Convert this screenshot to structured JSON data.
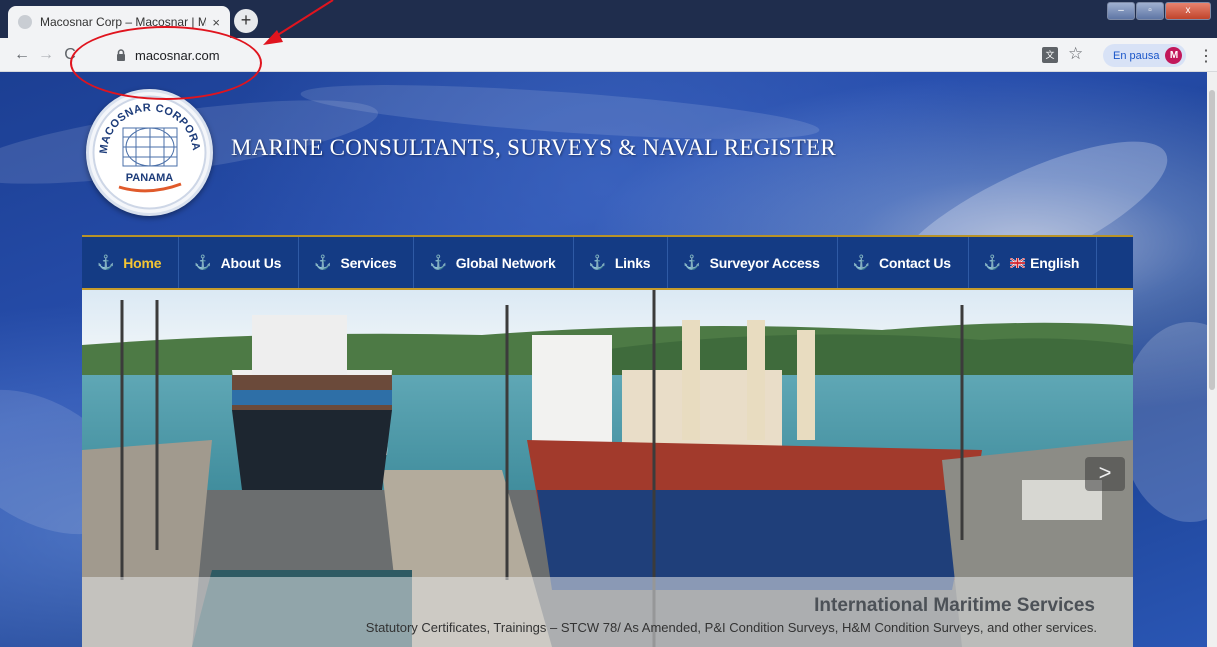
{
  "browser": {
    "tab_title": "Macosnar Corp – Macosnar | M...",
    "tab_close": "×",
    "new_tab": "+",
    "back": "←",
    "forward": "→",
    "reload": "C",
    "url": "macosnar.com",
    "star": "☆",
    "pause_label": "En pausa",
    "avatar_letter": "M",
    "menu": "⋮",
    "window_min": "–",
    "window_max": "▫",
    "window_close": "x"
  },
  "site": {
    "logo": {
      "top_text": "MACOSNAR CORPORATION",
      "bottom_text": "PANAMA"
    },
    "title": "MARINE CONSULTANTS, SURVEYS & NAVAL REGISTER",
    "nav": [
      {
        "label": "Home",
        "active": true,
        "icon": "anchor-icon"
      },
      {
        "label": "About Us",
        "active": false,
        "icon": "anchor-icon"
      },
      {
        "label": "Services",
        "active": false,
        "icon": "anchor-icon"
      },
      {
        "label": "Global Network",
        "active": false,
        "icon": "anchor-icon"
      },
      {
        "label": "Links",
        "active": false,
        "icon": "anchor-icon"
      },
      {
        "label": "Surveyor Access",
        "active": false,
        "icon": "anchor-icon"
      },
      {
        "label": "Contact Us",
        "active": false,
        "icon": "anchor-icon"
      },
      {
        "label": "English",
        "active": false,
        "icon": "anchor-icon",
        "flag": "uk-flag-icon"
      }
    ],
    "anchor_glyph": "⚓",
    "slider": {
      "caption_title": "International Maritime Services",
      "caption_text": "Statutory Certificates, Trainings – STCW 78/ As Amended, P&I Condition Surveys, H&M Condition Surveys, and other services.",
      "next_arrow": ">"
    }
  },
  "colors": {
    "navbar": "#143b84",
    "nav_active": "#f4c534",
    "nav_border": "#c69c2c",
    "annotation": "#e0141e"
  }
}
